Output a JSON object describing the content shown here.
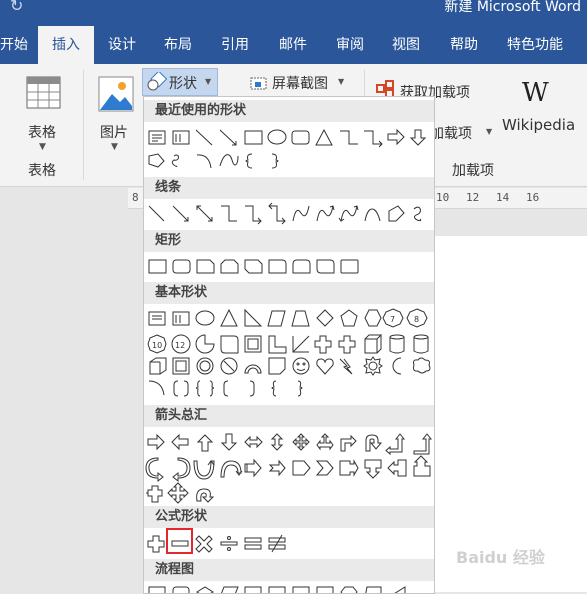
{
  "window": {
    "title": "新建 Microsoft Word",
    "undo_icon": "undo-icon"
  },
  "tabs": [
    "开始",
    "插入",
    "设计",
    "布局",
    "引用",
    "邮件",
    "审阅",
    "视图",
    "帮助",
    "特色功能"
  ],
  "active_tab": "插入",
  "ribbon": {
    "table_button": "表格",
    "table_group": "表格",
    "picture_button": "图片",
    "shapes_button": "形状",
    "screenshot_button": "屏幕截图",
    "get_addins": "获取加载项",
    "my_addins": "加载项",
    "wikipedia": "Wikipedia",
    "addins_group": "加载项"
  },
  "ruler_marks": [
    "8",
    "10",
    "12",
    "14",
    "16"
  ],
  "shapes_panel": {
    "sections": [
      "最近使用的形状",
      "线条",
      "矩形",
      "基本形状",
      "箭头总汇",
      "公式形状",
      "流程图"
    ],
    "selected_shape": "minus-sign-shape"
  },
  "accent_color": "#2b579a",
  "highlight_color": "#e5262a",
  "watermark": "Baidu 经验"
}
